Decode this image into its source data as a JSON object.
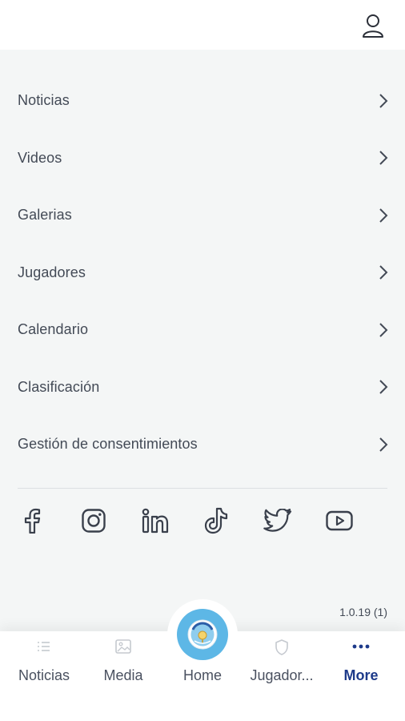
{
  "menu": {
    "items": [
      {
        "label": "Noticias"
      },
      {
        "label": "Videos"
      },
      {
        "label": "Galerias"
      },
      {
        "label": "Jugadores"
      },
      {
        "label": "Calendario"
      },
      {
        "label": "Clasificación"
      },
      {
        "label": "Gestión de consentimientos"
      }
    ]
  },
  "socials": [
    "facebook-icon",
    "instagram-icon",
    "linkedin-icon",
    "tiktok-icon",
    "twitter-icon",
    "youtube-icon"
  ],
  "version": "1.0.19 (1)",
  "tabs": [
    {
      "label": "Noticias",
      "icon": "list-icon"
    },
    {
      "label": "Media",
      "icon": "image-icon"
    },
    {
      "label": "Home",
      "icon": "club-crest-icon"
    },
    {
      "label": "Jugador...",
      "icon": "shield-icon"
    },
    {
      "label": "More",
      "icon": "more-dots-icon",
      "active": true
    }
  ],
  "colors": {
    "accent": "#1d3a8a",
    "home": "#5db7e6",
    "background": "#f4f6f6"
  }
}
